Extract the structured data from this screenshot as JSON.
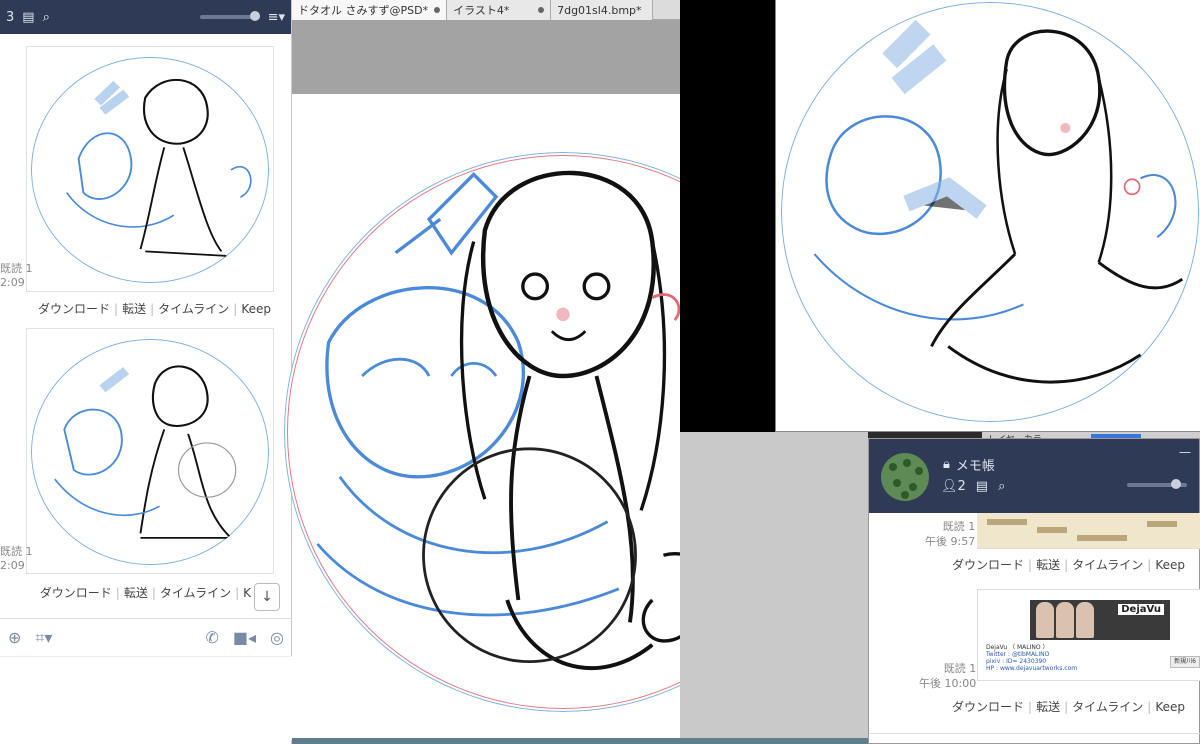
{
  "left_chat": {
    "title_count": "3",
    "messages": [
      {
        "read": "既読 1",
        "time": "2:09",
        "actions": [
          "ダウンロード",
          "転送",
          "タイムライン",
          "Keep"
        ]
      },
      {
        "read": "既読 1",
        "time": "2:09",
        "actions": [
          "ダウンロード",
          "転送",
          "タイムライン",
          "K"
        ]
      }
    ],
    "scroll_down_glyph": "↓"
  },
  "paint": {
    "tabs": [
      {
        "label": "ドタオル さみすず@PSD*",
        "active": true
      },
      {
        "label": "イラスト4*",
        "active": false
      },
      {
        "label": "7dg01sl4.bmp*",
        "active": false
      }
    ]
  },
  "layer_bar": {
    "label": "レイヤーカラー"
  },
  "memo": {
    "title": "メモ帳",
    "member_count": "2",
    "messages": [
      {
        "read": "既読 1",
        "time": "午後 9:57",
        "actions": [
          "ダウンロード",
          "転送",
          "タイムライン",
          "Keep"
        ]
      },
      {
        "read": "既読 1",
        "time": "午後 10:00",
        "actions": [
          "ダウンロード",
          "転送",
          "タイムライン",
          "Keep"
        ]
      }
    ],
    "card": {
      "banner": "DejaVu",
      "line1": "DejaVu （ MALINO ）",
      "line2": "Twitter : @tibMALINO",
      "line3": "pixiv : ID= 2430390",
      "line4": "HP : www.dejavuartworks.com",
      "button": "新規川6"
    }
  },
  "colors": {
    "header": "#2f3b56",
    "sketch_blue": "#4a8ad8",
    "accent_blue": "#3a78d8"
  }
}
